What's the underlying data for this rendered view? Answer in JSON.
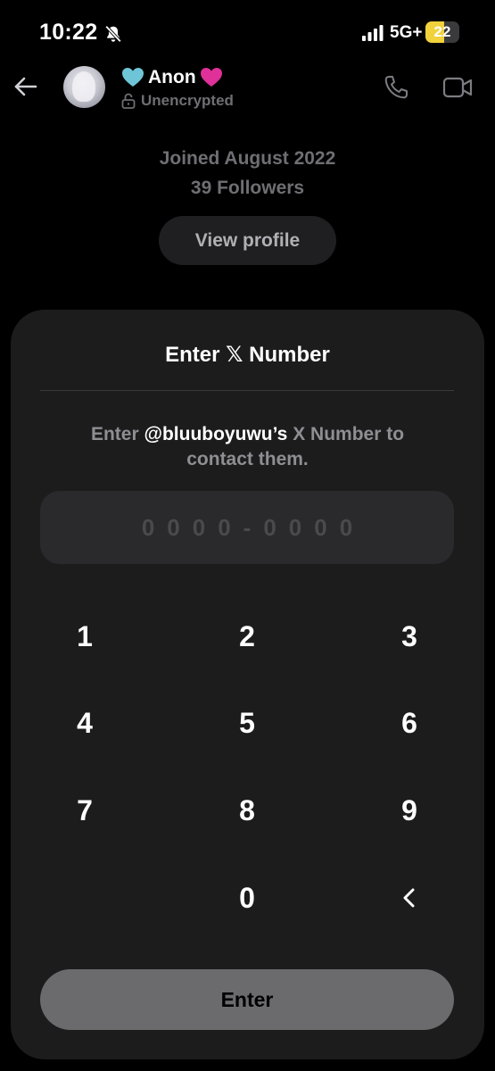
{
  "status_bar": {
    "time": "10:22",
    "network": "5G+",
    "battery_level": "22",
    "battery_fraction": 0.22,
    "battery_color": "#f2d23c"
  },
  "header": {
    "name": "Anon",
    "name_hearts": [
      "teal-heart-icon",
      "pink-heart-icon"
    ],
    "encryption_status": "Unencrypted"
  },
  "profile": {
    "joined": "Joined August 2022",
    "followers": "39 Followers",
    "view_profile_label": "View profile"
  },
  "sheet": {
    "title_prefix": "Enter",
    "title_logo": "𝕏",
    "title_suffix": "Number",
    "instruction_before": "Enter",
    "instruction_handle": "@bluuboyuwu’s",
    "instruction_after": "X Number to contact them.",
    "code_placeholder": "0000-0000",
    "keypad": {
      "k1": "1",
      "k2": "2",
      "k3": "3",
      "k4": "4",
      "k5": "5",
      "k6": "6",
      "k7": "7",
      "k8": "8",
      "k9": "9",
      "k0": "0"
    },
    "enter_label": "Enter"
  },
  "colors": {
    "background": "#000000",
    "sheet": "#1c1c1d",
    "muted_text": "#6e6e73",
    "enter_button": "#6b6b6e"
  }
}
